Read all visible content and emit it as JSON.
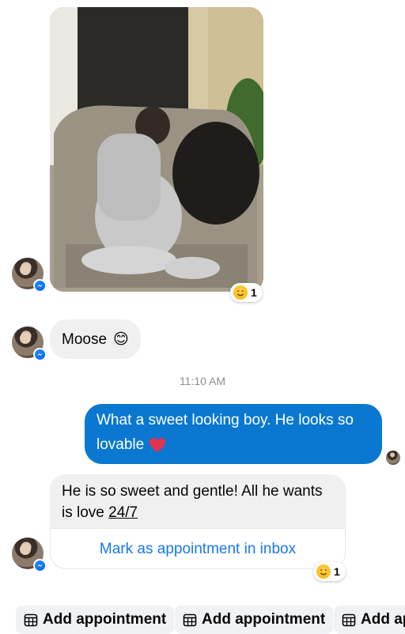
{
  "photo": {
    "alt": "",
    "reaction_count": "1"
  },
  "messages": [
    {
      "side": "in",
      "text": "Moose",
      "emoji": "😊"
    }
  ],
  "timestamp": "11:10 AM",
  "outgoing": {
    "text_line1": "What a sweet looking boy. He looks so",
    "text_line2": "lovable"
  },
  "incoming_card": {
    "text_prefix": "He is so sweet and gentle! All he wants is love ",
    "text_underlined": "24/7",
    "action_label": "Mark as appointment in inbox",
    "reaction_count": "1"
  },
  "quick_replies": [
    {
      "label": "Add appointment"
    },
    {
      "label": "Add appointment"
    },
    {
      "label": "Add ap"
    }
  ],
  "colors": {
    "outgoing_bubble": "#0a78d1",
    "incoming_bubble": "#f0f0f0",
    "link": "#1877f2",
    "messenger_badge": "#0a66e8"
  }
}
